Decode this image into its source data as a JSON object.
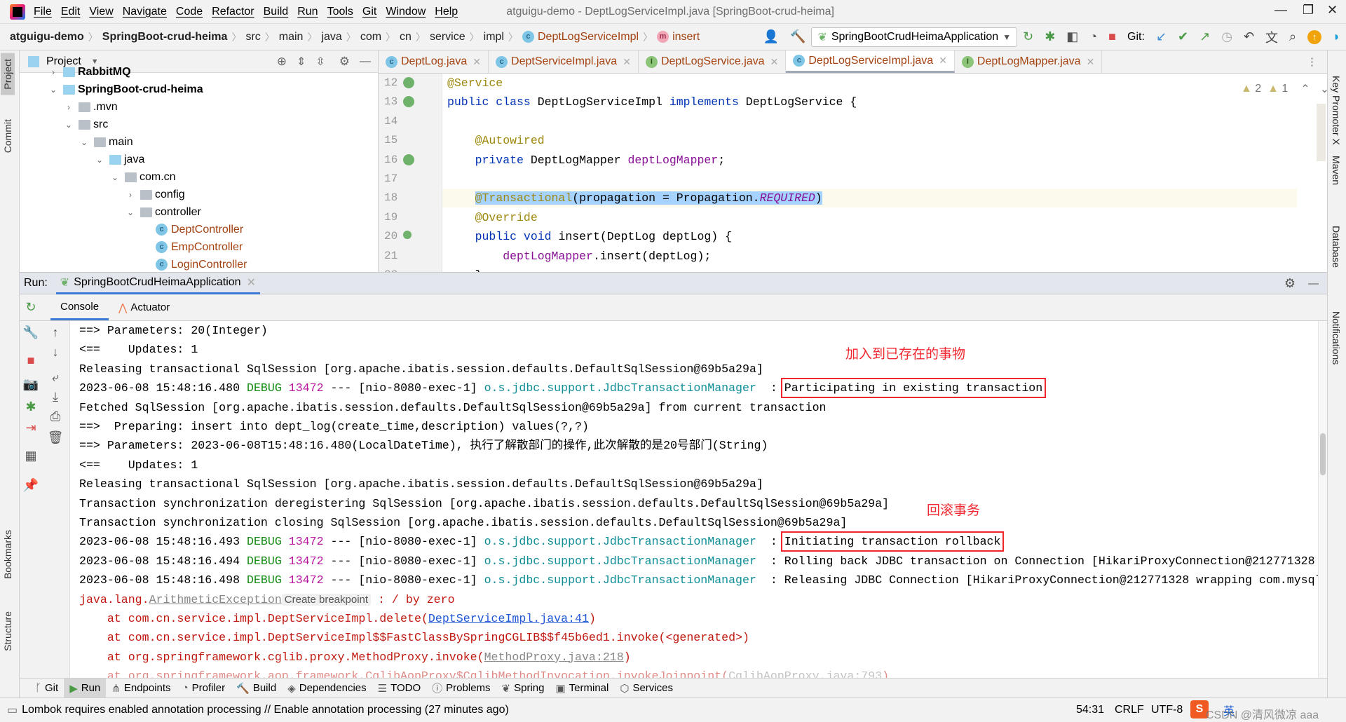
{
  "window": {
    "title": "atguigu-demo - DeptLogServiceImpl.java [SpringBoot-crud-heima]"
  },
  "menu": [
    "File",
    "Edit",
    "View",
    "Navigate",
    "Code",
    "Refactor",
    "Build",
    "Run",
    "Tools",
    "Git",
    "Window",
    "Help"
  ],
  "breadcrumb": [
    "atguigu-demo",
    "SpringBoot-crud-heima",
    "src",
    "main",
    "java",
    "com",
    "cn",
    "service",
    "impl",
    "DeptLogServiceImpl",
    "insert"
  ],
  "toolbar": {
    "run_config": "SpringBootCrudHeimaApplication",
    "git_label": "Git:"
  },
  "left_strip": [
    "Project",
    "Commit",
    "Bookmarks",
    "Structure"
  ],
  "right_strip": [
    "Key Promoter X",
    "Maven",
    "Database",
    "Notifications"
  ],
  "project": {
    "title": "Project",
    "items": [
      {
        "label": "RabbitMQ",
        "depth": 0,
        "type": "module",
        "state": "collapsed"
      },
      {
        "label": "SpringBoot-crud-heima",
        "depth": 0,
        "type": "module",
        "state": "expanded"
      },
      {
        "label": ".mvn",
        "depth": 1,
        "type": "folder",
        "state": "collapsed"
      },
      {
        "label": "src",
        "depth": 1,
        "type": "folder",
        "state": "expanded"
      },
      {
        "label": "main",
        "depth": 2,
        "type": "folder",
        "state": "expanded"
      },
      {
        "label": "java",
        "depth": 3,
        "type": "src",
        "state": "expanded"
      },
      {
        "label": "com.cn",
        "depth": 4,
        "type": "package",
        "state": "expanded"
      },
      {
        "label": "config",
        "depth": 5,
        "type": "package",
        "state": "collapsed"
      },
      {
        "label": "controller",
        "depth": 5,
        "type": "package",
        "state": "expanded"
      },
      {
        "label": "DeptController",
        "depth": 6,
        "type": "class"
      },
      {
        "label": "EmpController",
        "depth": 6,
        "type": "class"
      },
      {
        "label": "LoginController",
        "depth": 6,
        "type": "class"
      }
    ]
  },
  "tabs": [
    {
      "label": "DeptLog.java",
      "icon": "C",
      "active": false
    },
    {
      "label": "DeptServiceImpl.java",
      "icon": "C",
      "active": false
    },
    {
      "label": "DeptLogService.java",
      "icon": "I",
      "active": false
    },
    {
      "label": "DeptLogServiceImpl.java",
      "icon": "C",
      "active": true
    },
    {
      "label": "DeptLogMapper.java",
      "icon": "I",
      "active": false
    }
  ],
  "editor": {
    "inspections": {
      "warnings": "2",
      "weak_warnings": "1"
    },
    "current_line": 18,
    "lines": [
      {
        "n": "12",
        "seg": [
          [
            "an",
            "@Service"
          ]
        ]
      },
      {
        "n": "13",
        "seg": [
          [
            "k",
            "public class "
          ],
          [
            "",
            "DeptLogServiceImpl "
          ],
          [
            "k",
            "implements "
          ],
          [
            "",
            "DeptLogService {"
          ]
        ]
      },
      {
        "n": "14",
        "seg": []
      },
      {
        "n": "15",
        "seg": [
          [
            "an",
            "    @Autowired"
          ]
        ]
      },
      {
        "n": "16",
        "seg": [
          [
            "k",
            "    private "
          ],
          [
            "",
            "DeptLogMapper "
          ],
          [
            "f",
            "deptLogMapper"
          ],
          [
            "",
            ";"
          ]
        ]
      },
      {
        "n": "17",
        "seg": []
      },
      {
        "n": "18",
        "seg": [
          [
            "",
            "    "
          ],
          [
            "an sel",
            "@Transactional"
          ],
          [
            "sel",
            "(propagation = Propagation."
          ],
          [
            "it sel",
            "REQUIRED"
          ],
          [
            "sel",
            ")"
          ]
        ]
      },
      {
        "n": "19",
        "seg": [
          [
            "an",
            "    @Override"
          ]
        ]
      },
      {
        "n": "20",
        "seg": [
          [
            "k",
            "    public void "
          ],
          [
            "",
            "insert(DeptLog deptLog) {"
          ]
        ]
      },
      {
        "n": "21",
        "seg": [
          [
            "f",
            "        deptLogMapper"
          ],
          [
            "",
            ".insert(deptLog);"
          ]
        ]
      },
      {
        "n": "22",
        "seg": [
          [
            "",
            "    }"
          ]
        ]
      }
    ]
  },
  "run": {
    "label": "Run:",
    "config": "SpringBootCrudHeimaApplication",
    "tabs": [
      "Console",
      "Actuator"
    ]
  },
  "console": {
    "lines": [
      [
        [
          "",
          "==> Parameters: 20(Integer)"
        ]
      ],
      [
        [
          "",
          "<==    Updates: 1"
        ]
      ],
      [
        [
          "",
          "Releasing transactional SqlSession [org.apache.ibatis.session.defaults.DefaultSqlSession@69b5a29a]"
        ]
      ],
      [
        [
          "",
          "2023-06-08 15:48:16.480 "
        ],
        [
          "debug",
          "DEBUG "
        ],
        [
          "pid",
          "13472"
        ],
        [
          "",
          " --- [nio-8080-exec-1] "
        ],
        [
          "logger",
          "o.s.jdbc.support.JdbcTransactionManager"
        ],
        [
          "",
          "  : "
        ],
        [
          "box",
          "Participating in existing transaction"
        ]
      ],
      [
        [
          "",
          "Fetched SqlSession [org.apache.ibatis.session.defaults.DefaultSqlSession@69b5a29a] from current transaction"
        ]
      ],
      [
        [
          "",
          "==>  Preparing: insert into dept_log(create_time,description) values(?,?)"
        ]
      ],
      [
        [
          "",
          "==> Parameters: 2023-06-08T15:48:16.480(LocalDateTime), 执行了解散部门的操作,此次解散的是20号部门(String)"
        ]
      ],
      [
        [
          "",
          "<==    Updates: 1"
        ]
      ],
      [
        [
          "",
          "Releasing transactional SqlSession [org.apache.ibatis.session.defaults.DefaultSqlSession@69b5a29a]"
        ]
      ],
      [
        [
          "",
          "Transaction synchronization deregistering SqlSession [org.apache.ibatis.session.defaults.DefaultSqlSession@69b5a29a]"
        ]
      ],
      [
        [
          "",
          "Transaction synchronization closing SqlSession [org.apache.ibatis.session.defaults.DefaultSqlSession@69b5a29a]"
        ]
      ],
      [
        [
          "",
          "2023-06-08 15:48:16.493 "
        ],
        [
          "debug",
          "DEBUG "
        ],
        [
          "pid",
          "13472"
        ],
        [
          "",
          " --- [nio-8080-exec-1] "
        ],
        [
          "logger",
          "o.s.jdbc.support.JdbcTransactionManager"
        ],
        [
          "",
          "  : "
        ],
        [
          "box",
          "Initiating transaction rollback"
        ]
      ],
      [
        [
          "",
          "2023-06-08 15:48:16.494 "
        ],
        [
          "debug",
          "DEBUG "
        ],
        [
          "pid",
          "13472"
        ],
        [
          "",
          " --- [nio-8080-exec-1] "
        ],
        [
          "logger",
          "o.s.jdbc.support.JdbcTransactionManager"
        ],
        [
          "",
          "  : Rolling back JDBC transaction on Connection [HikariProxyConnection@212771328"
        ]
      ],
      [
        [
          "",
          "2023-06-08 15:48:16.498 "
        ],
        [
          "debug",
          "DEBUG "
        ],
        [
          "pid",
          "13472"
        ],
        [
          "",
          " --- [nio-8080-exec-1] "
        ],
        [
          "logger",
          "o.s.jdbc.support.JdbcTransactionManager"
        ],
        [
          "",
          "  : Releasing JDBC Connection [HikariProxyConnection@212771328 wrapping com.mysql"
        ]
      ],
      [
        [
          "err",
          "java.lang."
        ],
        [
          "glink",
          "ArithmeticException"
        ],
        [
          "hint",
          "Create breakpoint"
        ],
        [
          "err",
          " : / by zero"
        ]
      ],
      [
        [
          "err",
          "    at com.cn.service.impl.DeptServiceImpl.delete("
        ],
        [
          "link",
          "DeptServiceImpl.java:41"
        ],
        [
          "err",
          ")"
        ]
      ],
      [
        [
          "err",
          "    at com.cn.service.impl.DeptServiceImpl$$FastClassBySpringCGLIB$$f45b6ed1.invoke(<generated>)"
        ]
      ],
      [
        [
          "err",
          "    at org.springframework.cglib.proxy.MethodProxy.invoke("
        ],
        [
          "glink",
          "MethodProxy.java:218"
        ],
        [
          "err",
          ")"
        ]
      ],
      [
        [
          "err",
          "    at org.springframework.aop.framework.CglibAopProxy$CglibMethodInvocation.invokeJoinpoint("
        ],
        [
          "glink",
          "CglibAopProxy.java:793"
        ],
        [
          "err",
          ")"
        ]
      ]
    ]
  },
  "annotations": {
    "participating": "加入到已存在的事物",
    "rollback": "回滚事务",
    "color": "#f0272f"
  },
  "bottom_tabs": [
    "Git",
    "Run",
    "Endpoints",
    "Profiler",
    "Build",
    "Dependencies",
    "TODO",
    "Problems",
    "Spring",
    "Terminal",
    "Services"
  ],
  "status": {
    "message": "Lombok requires enabled annotation processing // Enable annotation processing (27 minutes ago)",
    "position": "54:31",
    "line_sep": "CRLF",
    "encoding": "UTF-8",
    "ime": "英",
    "watermark": "CSDN @清风微凉 aaa"
  }
}
